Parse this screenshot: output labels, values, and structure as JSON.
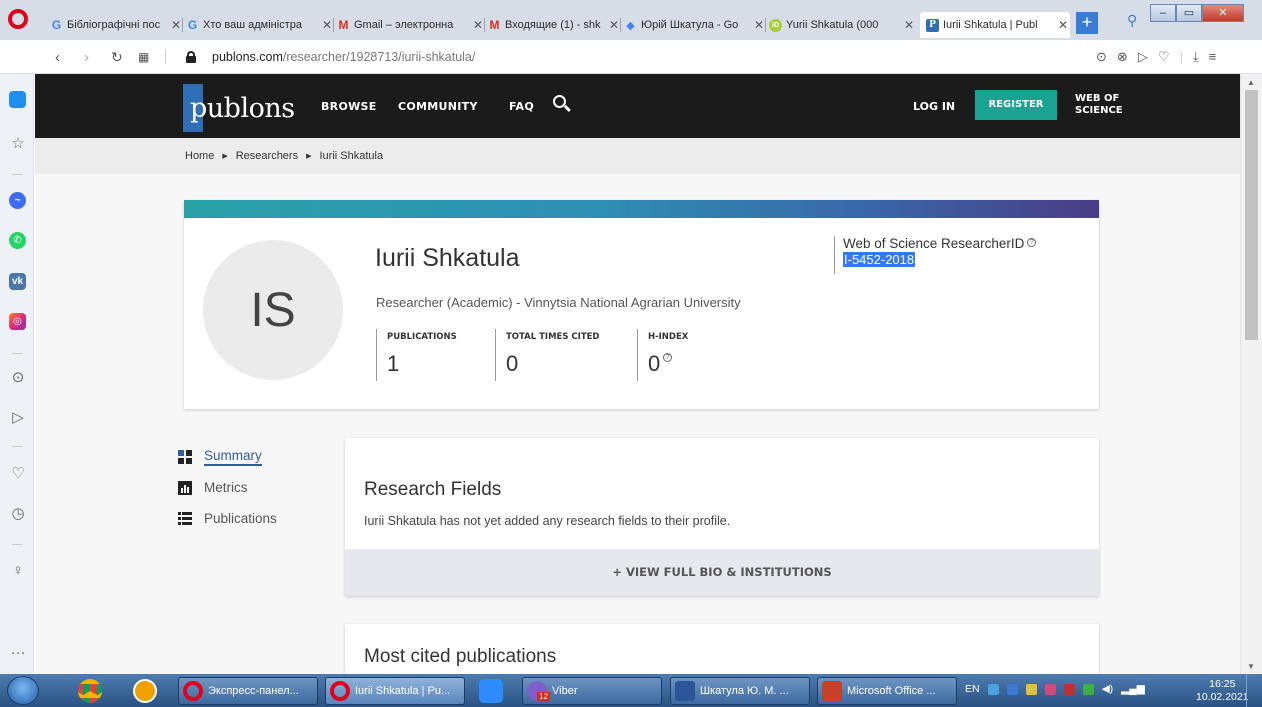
{
  "browser": {
    "tabs": [
      {
        "title": "Бібліографічні пос",
        "icon": "google-icon",
        "color": "#4285f4",
        "glyph": "G"
      },
      {
        "title": "Хто ваш адміністра",
        "icon": "google-icon",
        "color": "#4285f4",
        "glyph": "G"
      },
      {
        "title": "Gmail – электронна",
        "icon": "gmail-icon",
        "color": "#d93025",
        "glyph": "M"
      },
      {
        "title": "Входящие (1) - shk",
        "icon": "gmail-icon",
        "color": "#d93025",
        "glyph": "M"
      },
      {
        "title": "Юрій Шкатула - Go",
        "icon": "scholar-icon",
        "color": "#4285f4",
        "glyph": "◆"
      },
      {
        "title": "Yurii Shkatula (000",
        "icon": "orcid-icon",
        "color": "#a6ce39",
        "glyph": "iD"
      },
      {
        "title": "Iurii Shkatula | Publ",
        "icon": "publons-icon",
        "color": "#2f6db5",
        "glyph": "P"
      }
    ],
    "url_host": "publons.com",
    "url_path": "/researcher/1928713/iurii-shkatula/"
  },
  "header": {
    "logo": "publons",
    "nav": [
      "BROWSE",
      "COMMUNITY",
      "FAQ"
    ],
    "login": "LOG IN",
    "register": "REGISTER",
    "wos_line1": "WEB OF",
    "wos_line2": "SCIENCE",
    "brand_color": "#1b1b1b",
    "accent": "#1aa393"
  },
  "breadcrumb": [
    "Home",
    "Researchers",
    "Iurii Shkatula"
  ],
  "profile": {
    "initials": "IS",
    "name": "Iurii Shkatula",
    "role": "Researcher (Academic) - Vinnytsia National Agrarian University",
    "metrics": [
      {
        "label": "PUBLICATIONS",
        "value": "1"
      },
      {
        "label": "TOTAL TIMES CITED",
        "value": "0"
      },
      {
        "label": "H-INDEX",
        "value": "0"
      }
    ],
    "wos_label": "Web of Science ResearcherID",
    "wos_id": "I-5452-2018"
  },
  "sidenav": [
    "Summary",
    "Metrics",
    "Publications"
  ],
  "research_fields": {
    "title": "Research Fields",
    "text": "Iurii Shkatula has not yet added any research fields to their profile.",
    "button": "+ VIEW FULL BIO & INSTITUTIONS"
  },
  "most_cited": {
    "title": "Most cited publications"
  },
  "taskbar": {
    "tasks": [
      "Экспресс-панел...",
      "Iurii Shkatula | Pu...",
      "Viber",
      "Шкатула Ю. М. ...",
      "Microsoft Office ..."
    ],
    "viber_badge": "12",
    "lang": "EN",
    "time": "16:25",
    "date": "10.02.2021"
  }
}
